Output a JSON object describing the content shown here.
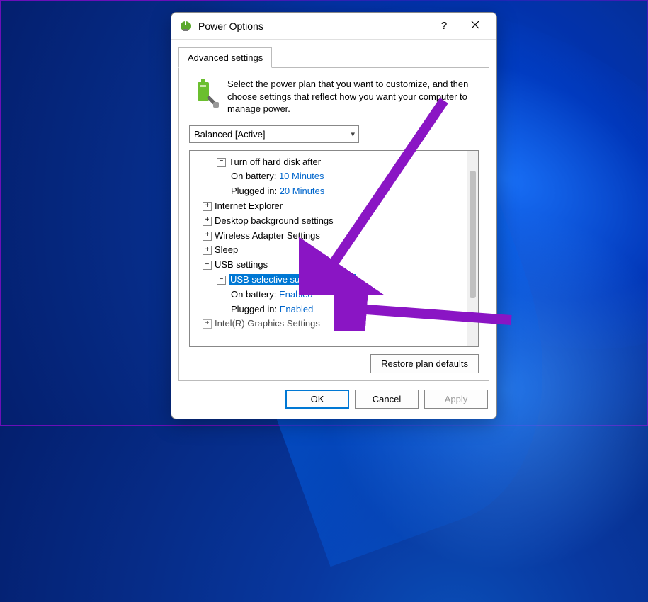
{
  "window": {
    "title": "Power Options",
    "help_label": "?",
    "close_label": "✕"
  },
  "tab": {
    "label": "Advanced settings"
  },
  "description": "Select the power plan that you want to customize, and then choose settings that reflect how you want your computer to manage power.",
  "plan_selector": {
    "selected": "Balanced [Active]"
  },
  "tree": {
    "hard_disk": {
      "label": "Turn off hard disk after",
      "on_battery_label": "On battery:",
      "on_battery_value": "10 Minutes",
      "plugged_in_label": "Plugged in:",
      "plugged_in_value": "20 Minutes"
    },
    "ie": {
      "label": "Internet Explorer"
    },
    "desktop_bg": {
      "label": "Desktop background settings"
    },
    "wireless": {
      "label": "Wireless Adapter Settings"
    },
    "sleep": {
      "label": "Sleep"
    },
    "usb": {
      "label": "USB settings",
      "selective": {
        "label": "USB selective suspend setting",
        "on_battery_label": "On battery:",
        "on_battery_value": "Enabled",
        "plugged_in_label": "Plugged in:",
        "plugged_in_value": "Enabled"
      }
    },
    "graphics": {
      "label": "Intel(R) Graphics Settings"
    }
  },
  "buttons": {
    "restore": "Restore plan defaults",
    "ok": "OK",
    "cancel": "Cancel",
    "apply": "Apply"
  }
}
